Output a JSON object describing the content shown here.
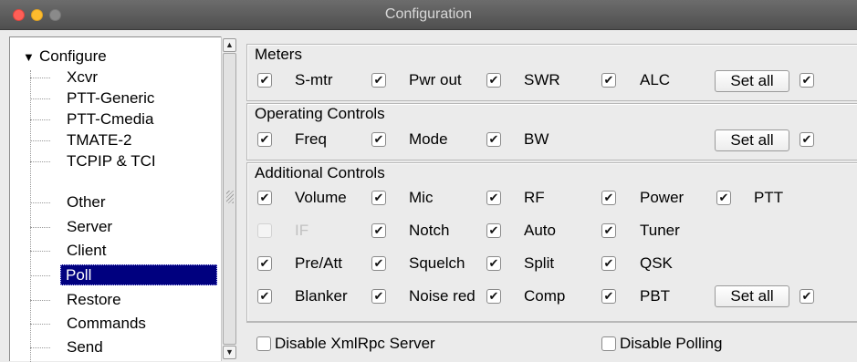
{
  "window": {
    "title": "Configuration"
  },
  "tree": {
    "root": "Configure",
    "items": [
      "Xcvr",
      "PTT-Generic",
      "PTT-Cmedia",
      "TMATE-2",
      "TCPIP & TCI",
      "Other",
      "Server",
      "Client",
      "Poll",
      "Restore",
      "Commands",
      "Send"
    ],
    "selected": "Poll"
  },
  "meters": {
    "title": "Meters",
    "items": [
      {
        "label": "S-mtr",
        "checked": true
      },
      {
        "label": "Pwr out",
        "checked": true
      },
      {
        "label": "SWR",
        "checked": true
      },
      {
        "label": "ALC",
        "checked": true
      }
    ],
    "set_all_label": "Set all",
    "set_all_checked": true
  },
  "operating": {
    "title": "Operating Controls",
    "items": [
      {
        "label": "Freq",
        "checked": true
      },
      {
        "label": "Mode",
        "checked": true
      },
      {
        "label": "BW",
        "checked": true
      }
    ],
    "set_all_label": "Set all",
    "set_all_checked": true
  },
  "additional": {
    "title": "Additional Controls",
    "items": [
      {
        "label": "Volume",
        "checked": true,
        "enabled": true
      },
      {
        "label": "Mic",
        "checked": true,
        "enabled": true
      },
      {
        "label": "RF",
        "checked": true,
        "enabled": true
      },
      {
        "label": "Power",
        "checked": true,
        "enabled": true
      },
      {
        "label": "PTT",
        "checked": true,
        "enabled": true
      },
      {
        "label": "IF",
        "checked": false,
        "enabled": false
      },
      {
        "label": "Notch",
        "checked": true,
        "enabled": true
      },
      {
        "label": "Auto",
        "checked": true,
        "enabled": true
      },
      {
        "label": "Tuner",
        "checked": true,
        "enabled": true
      },
      {
        "label": "Pre/Att",
        "checked": true,
        "enabled": true
      },
      {
        "label": "Squelch",
        "checked": true,
        "enabled": true
      },
      {
        "label": "Split",
        "checked": true,
        "enabled": true
      },
      {
        "label": "QSK",
        "checked": true,
        "enabled": true
      },
      {
        "label": "Blanker",
        "checked": true,
        "enabled": true
      },
      {
        "label": "Noise red",
        "checked": true,
        "enabled": true
      },
      {
        "label": "Comp",
        "checked": true,
        "enabled": true
      },
      {
        "label": "PBT",
        "checked": true,
        "enabled": true
      }
    ],
    "set_all_label": "Set all",
    "set_all_checked": true
  },
  "options": {
    "disable_xmlrpc_label": "Disable XmlRpc Server",
    "disable_xmlrpc_checked": false,
    "disable_polling_label": "Disable Polling",
    "disable_polling_checked": false
  },
  "check_glyph": "✔"
}
